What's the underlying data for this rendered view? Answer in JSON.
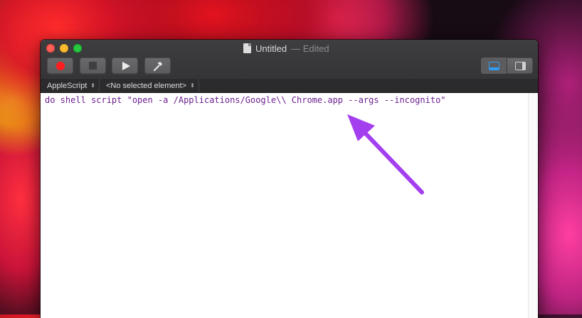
{
  "window": {
    "title": "Untitled",
    "title_status": "— Edited"
  },
  "toolbar": {
    "record_label": "Record",
    "stop_label": "Stop",
    "run_label": "Run",
    "compile_label": "Compile",
    "record_color": "#ff1d1d",
    "accent_color": "#2f9cf5"
  },
  "navbar": {
    "language": "AppleScript",
    "element": "<No selected element>"
  },
  "editor": {
    "code": "do shell script \"open -a /Applications/Google\\\\ Chrome.app --args --incognito\"",
    "code_color": "#6b1f8f"
  },
  "annotation": {
    "arrow_color": "#a43ff0"
  }
}
